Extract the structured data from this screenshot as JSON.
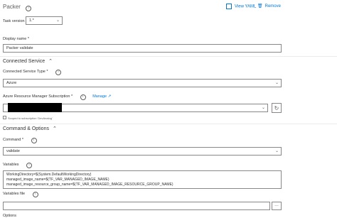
{
  "header": {
    "title": "Packer",
    "view_yaml": "View YAML",
    "remove": "Remove"
  },
  "task_version": {
    "label": "Task version",
    "value": "1.*"
  },
  "display_name": {
    "label": "Display name *",
    "value": "Packer validate"
  },
  "connected_service": {
    "section_title": "Connected Service",
    "type_label": "Connected Service Type *",
    "type_value": "Azure",
    "subscription_label": "Azure Resource Manager Subscription *",
    "manage": "Manage",
    "scoped_note": "Scoped to subscription 'DevAnalog'"
  },
  "command_options": {
    "section_title": "Command & Options",
    "command_label": "Command *",
    "command_value": "validate",
    "variables_label": "Variables",
    "variables_lines": [
      "WorkingDirectory=$(System.DefaultWorkingDirectory)",
      "managed_image_name=$(TF_VAR_MANAGED_IMAGE_NAME)",
      "managed_image_resource_group_name=$(TF_VAR_MANAGED_IMAGE_RESOURCE_GROUP_NAME)"
    ],
    "variables_file_label": "Variables file",
    "browse": "...",
    "options_label": "Options"
  },
  "colors": {
    "accent": "#0078d4",
    "border": "#8a8886",
    "redaction": "#000000"
  },
  "icons": [
    "info-icon",
    "view-yaml-icon",
    "remove-icon",
    "chevron-down-icon",
    "chevron-up-icon",
    "external-link-icon",
    "refresh-icon"
  ]
}
